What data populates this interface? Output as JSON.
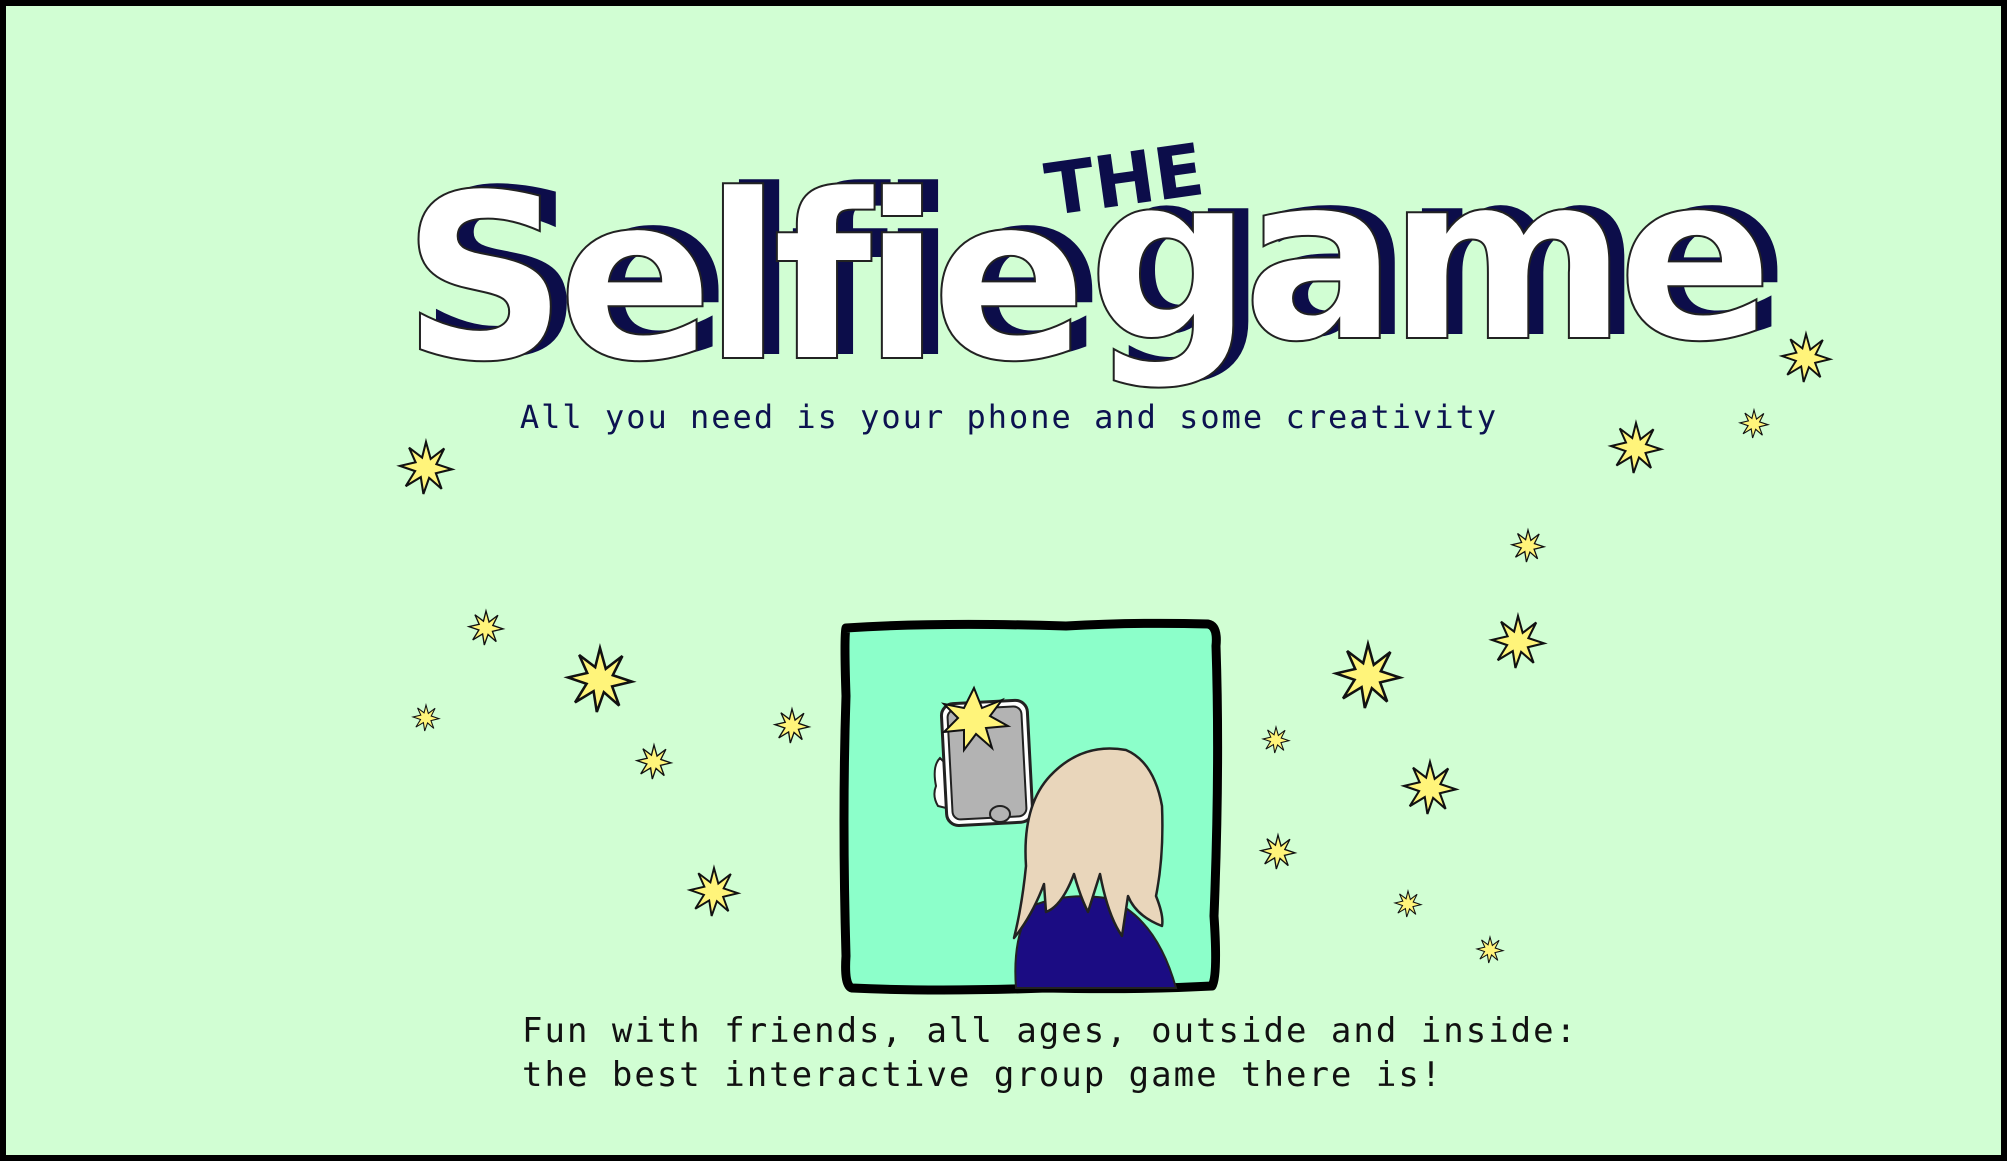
{
  "title": {
    "word1": "Selfie",
    "the": "THE",
    "word2": "game"
  },
  "tagline": "All you need is your phone and some creativity",
  "description": {
    "line1": "Fun with friends, all ages, outside and inside:",
    "line2": "the best interactive group game there is!"
  },
  "colors": {
    "background": "#d1fed3",
    "border": "#000000",
    "title_fill": "#ffffff",
    "title_shadow": "#0c0d4a",
    "tagline": "#0c1250",
    "frame_fill": "#8cffca",
    "sparkle": "#fff47a",
    "hair": "#e9d6bb",
    "shirt": "#1b0c83",
    "phone": "#b3b3b3"
  },
  "icons": [
    "sparkle-icon",
    "selfie-illustration"
  ]
}
